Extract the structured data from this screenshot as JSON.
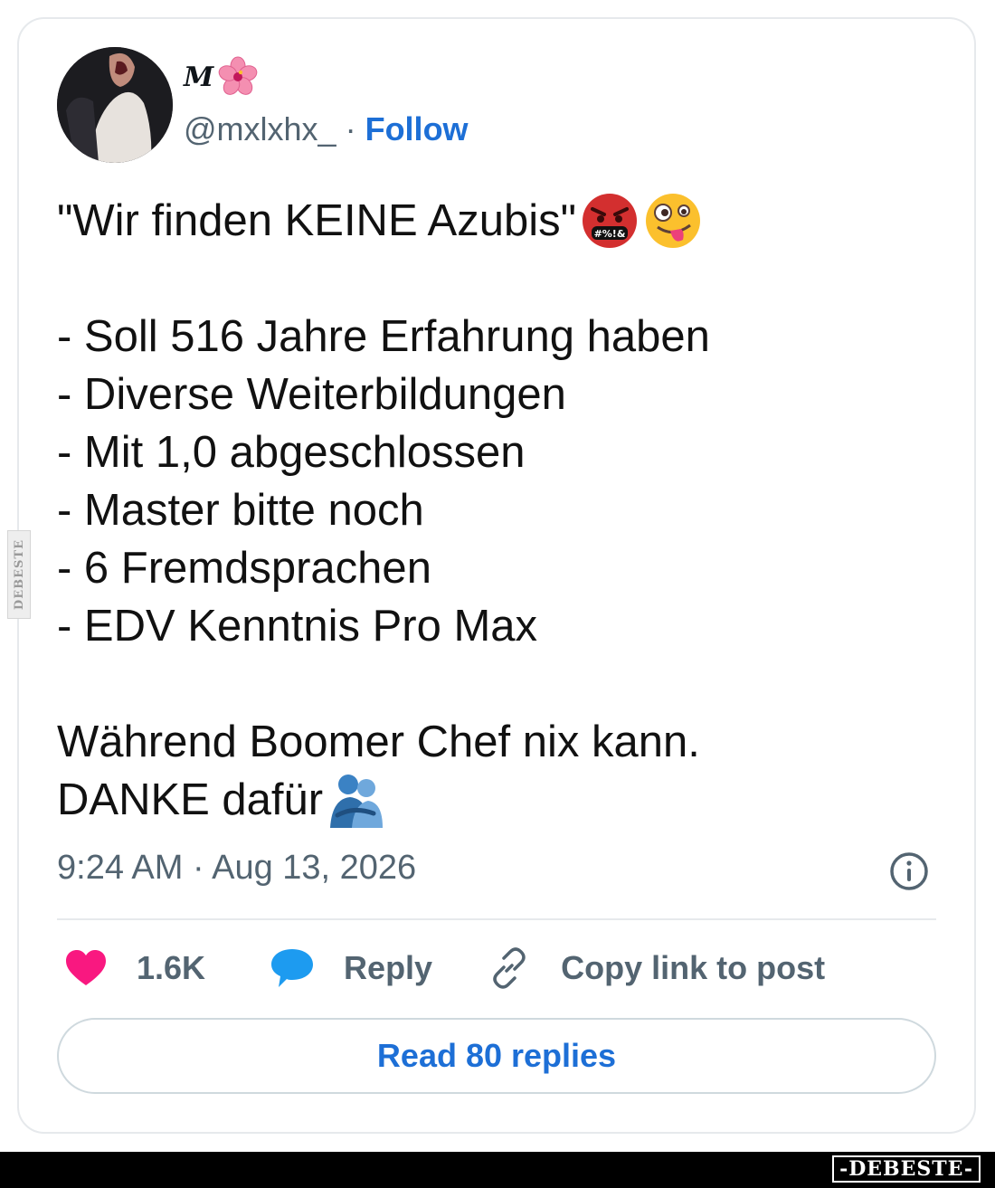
{
  "post": {
    "display_name": "M",
    "display_name_emoji": "hibiscus-icon",
    "handle": "@mxlxhx_",
    "separator": "·",
    "follow_label": "Follow",
    "text_lines": [
      "\"Wir finden KEINE Azubis\"",
      "",
      "- Soll 516 Jahre Erfahrung haben",
      "- Diverse Weiterbildungen",
      "- Mit 1,0 abgeschlossen",
      "- Master bitte noch",
      "- 6 Fremdsprachen",
      "- EDV Kenntnis Pro Max",
      "",
      "Während Boomer Chef nix kann.",
      "DANKE dafür"
    ],
    "cursing_emoji_text": "#%!&",
    "emojis": [
      "face-with-symbols-on-mouth-icon",
      "zany-face-icon",
      "people-hugging-icon"
    ],
    "timestamp": "9:24 AM · Aug 13, 2026"
  },
  "actions": {
    "like_count": "1.6K",
    "reply_label": "Reply",
    "copy_label": "Copy link to post"
  },
  "read_replies_label": "Read 80 replies",
  "watermark": {
    "side_text": "DEBESTE",
    "footer_text": "-DEBESTE-"
  },
  "colors": {
    "accent": "#1d6fd6",
    "like": "#f91880",
    "reply": "#1d9bf0",
    "secondary_text": "#536471"
  }
}
